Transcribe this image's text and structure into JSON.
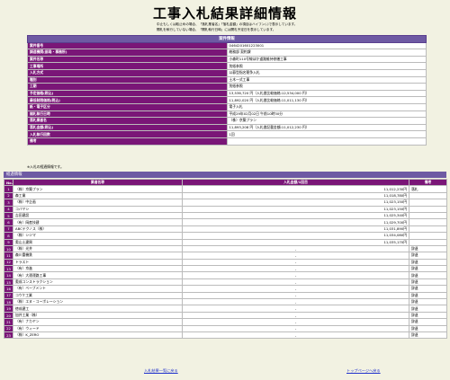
{
  "page": {
    "title": "工事入札結果詳細情報",
    "notes": [
      "中止もしくは取止めの場合、「落札業者名」「落札金額」の項目はハイフン(-)で表示しています。",
      "開札を執行していない場合、「開札執行日時」には開札予定日を表示しています。"
    ]
  },
  "project_info": {
    "header": "案件情報",
    "rows": [
      {
        "label": "案件番号",
        "value": "0464201601223001"
      },
      {
        "label": "調達機関(部局・事務所)",
        "value": "総務部 契約課"
      },
      {
        "label": "案件名称",
        "value": "小森町110号線ほか道路維持修繕工事"
      },
      {
        "label": "工事場所",
        "value": "別紙参照"
      },
      {
        "label": "入札方式",
        "value": "公募型指名競争入札"
      },
      {
        "label": "種別",
        "value": "土木一式工事"
      },
      {
        "label": "工期",
        "value": "別紙参照"
      },
      {
        "label": "予定価格(税込)",
        "value": "13,536,720 円（入札書比較価格:12,534,000 円）"
      },
      {
        "label": "最低制限価格(税込)",
        "value": "11,892,020 円（入札書比較価格:11,011,130 円）"
      },
      {
        "label": "紙・電子区分",
        "value": "電子入札"
      },
      {
        "label": "開札執行日時",
        "value": "平成29年02月02日 午前10時30分"
      },
      {
        "label": "落札業者名",
        "value": "（株）京築プラン"
      },
      {
        "label": "落札金額(税込)",
        "value": "11,893,208 円（入札書記載金額:11,012,230 円）"
      },
      {
        "label": "入札執行回数",
        "value": "1回"
      },
      {
        "label": "備考",
        "value": ""
      }
    ]
  },
  "bid_progress_note": "※入札の経過情報です。",
  "bid_history": {
    "section_label": "経過情報",
    "columns": [
      "No.",
      "業者名称",
      "入札金額/1回目",
      "備考"
    ],
    "rows": [
      {
        "no": "1",
        "name": "（株）京築プラン",
        "amount": "11,012,230円",
        "remark": "落札"
      },
      {
        "no": "2",
        "name": "森工業",
        "amount": "11,018,780円",
        "remark": ""
      },
      {
        "no": "3",
        "name": "（株）中企画",
        "amount": "11,023,150円",
        "remark": ""
      },
      {
        "no": "4",
        "name": "コバヤシ",
        "amount": "11,023,150円",
        "remark": ""
      },
      {
        "no": "5",
        "name": "吉田建設",
        "amount": "11,025,340円",
        "remark": ""
      },
      {
        "no": "6",
        "name": "（有）岡産技建",
        "amount": "11,029,700円",
        "remark": ""
      },
      {
        "no": "7",
        "name": "ABCテクノス（株）",
        "amount": "11,031,890円",
        "remark": ""
      },
      {
        "no": "8",
        "name": "（株）シジマ",
        "amount": "11,034,080円",
        "remark": ""
      },
      {
        "no": "9",
        "name": "奥山土建興",
        "amount": "11,035,170円",
        "remark": ""
      },
      {
        "no": "10",
        "name": "（株）光井",
        "amount": "-",
        "remark": "辞退"
      },
      {
        "no": "11",
        "name": "森川重機鉄",
        "amount": "-",
        "remark": "辞退"
      },
      {
        "no": "12",
        "name": "トラスト",
        "amount": "-",
        "remark": "辞退"
      },
      {
        "no": "13",
        "name": "（有）京進",
        "amount": "-",
        "remark": "辞退"
      },
      {
        "no": "14",
        "name": "（有）大運運路工事",
        "amount": "-",
        "remark": "辞退"
      },
      {
        "no": "15",
        "name": "奥成コンストラクション",
        "amount": "-",
        "remark": "辞退"
      },
      {
        "no": "16",
        "name": "（有）ベーブメント",
        "amount": "-",
        "remark": "辞退"
      },
      {
        "no": "17",
        "name": "コウケ工業",
        "amount": "-",
        "remark": "辞退"
      },
      {
        "no": "18",
        "name": "（株）エヌ・コーポレーション",
        "amount": "-",
        "remark": "辞退"
      },
      {
        "no": "19",
        "name": "徳成建工",
        "amount": "-",
        "remark": "辞退"
      },
      {
        "no": "20",
        "name": "加井工業（株）",
        "amount": "-",
        "remark": "辞退"
      },
      {
        "no": "21",
        "name": "（有）ナカヤン",
        "amount": "-",
        "remark": "辞退"
      },
      {
        "no": "22",
        "name": "（有）ウィード",
        "amount": "-",
        "remark": "辞退"
      },
      {
        "no": "23",
        "name": "（株）K_ZERO",
        "amount": "-",
        "remark": "辞退"
      }
    ]
  },
  "links": {
    "back_to_list": "入札結果一覧に戻る",
    "back_to_top": "トップページへ戻る"
  }
}
